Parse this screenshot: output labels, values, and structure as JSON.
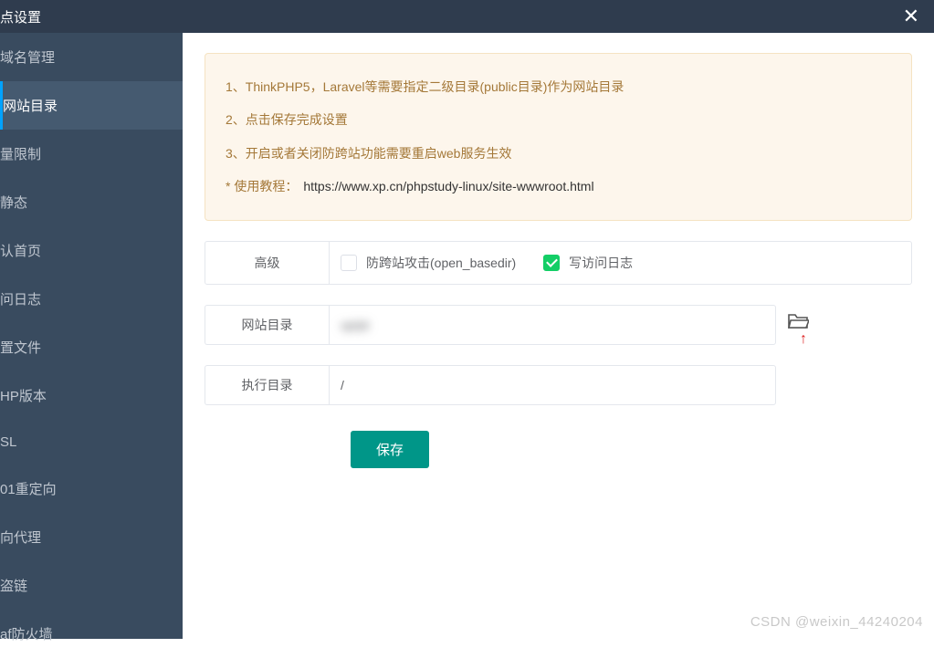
{
  "header": {
    "title": "点设置"
  },
  "sidebar": {
    "items": [
      {
        "label": "域名管理"
      },
      {
        "label": "网站目录"
      },
      {
        "label": "量限制"
      },
      {
        "label": "静态"
      },
      {
        "label": "认首页"
      },
      {
        "label": "问日志"
      },
      {
        "label": "置文件"
      },
      {
        "label": "HP版本"
      },
      {
        "label": "SL"
      },
      {
        "label": "01重定向"
      },
      {
        "label": "向代理"
      },
      {
        "label": "盗链"
      },
      {
        "label": "af防火墙"
      }
    ],
    "activeIndex": 1
  },
  "notes": {
    "line1": "1、ThinkPHP5，Laravel等需要指定二级目录(public目录)作为网站目录",
    "line2": "2、点击保存完成设置",
    "line3": "3、开启或者关闭防跨站功能需要重启web服务生效",
    "tutorialPrefix": "* 使用教程：",
    "tutorialLink": "https://www.xp.cn/phpstudy-linux/site-wwwroot.html"
  },
  "advanced": {
    "label": "高级",
    "checkbox1": {
      "label": "防跨站攻击(open_basedir)",
      "checked": false
    },
    "checkbox2": {
      "label": "写访问日志",
      "checked": true
    }
  },
  "form": {
    "siteDir": {
      "label": "网站目录",
      "value": "up/pt"
    },
    "execDir": {
      "label": "执行目录",
      "value": "/"
    }
  },
  "buttons": {
    "save": "保存"
  },
  "watermark": "CSDN @weixin_44240204"
}
